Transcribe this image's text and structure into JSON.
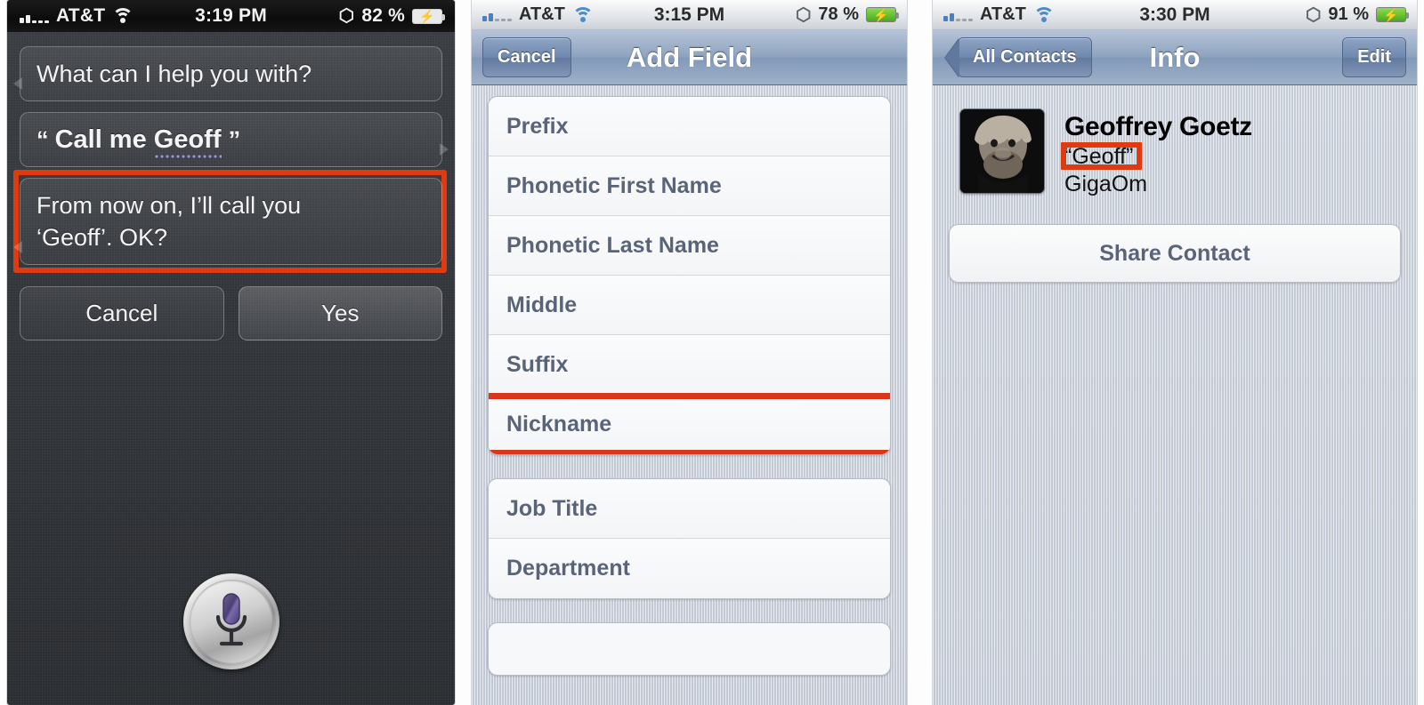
{
  "panels": {
    "siri": {
      "name": "Siri",
      "statusbar": {
        "carrier": "AT&T",
        "time": "3:19 PM",
        "battery_percent": "82 %",
        "signal_bars_filled": 2,
        "signal_bars_total": 5,
        "wifi_icon": "wifi-icon",
        "bluetooth_icon": "bluetooth-icon",
        "battery_icon": "battery-charging-icon"
      },
      "bubbles": [
        {
          "role": "siri",
          "text": "What can I help you with?"
        },
        {
          "role": "user",
          "prefix": "“",
          "text_before": "Call me ",
          "dotted_word": "Geoff",
          "suffix": "”"
        },
        {
          "role": "siri",
          "line1": "From now on, I’ll call you",
          "line2": "‘Geoff’. OK?",
          "highlighted": true
        }
      ],
      "buttons": {
        "cancel": "Cancel",
        "confirm": "Yes"
      },
      "mic_icon": "microphone-icon",
      "highlight_color": "#e03a10"
    },
    "add_field": {
      "statusbar": {
        "carrier": "AT&T",
        "time": "3:15 PM",
        "battery_percent": "78 %",
        "signal_bars_filled": 2,
        "signal_bars_total": 5,
        "wifi_icon": "wifi-icon",
        "bluetooth_icon": "bluetooth-icon",
        "battery_icon": "battery-charging-icon"
      },
      "navbar": {
        "left_button": "Cancel",
        "title": "Add Field"
      },
      "groups": [
        {
          "rows": [
            {
              "label": "Prefix",
              "highlighted": false
            },
            {
              "label": "Phonetic First Name",
              "highlighted": false
            },
            {
              "label": "Phonetic Last Name",
              "highlighted": false
            },
            {
              "label": "Middle",
              "highlighted": false
            },
            {
              "label": "Suffix",
              "highlighted": false
            },
            {
              "label": "Nickname",
              "highlighted": true
            }
          ]
        },
        {
          "rows": [
            {
              "label": "Job Title",
              "highlighted": false
            },
            {
              "label": "Department",
              "highlighted": false
            }
          ]
        }
      ],
      "highlight_color": "#d9361a"
    },
    "info": {
      "statusbar": {
        "carrier": "AT&T",
        "time": "3:30 PM",
        "battery_percent": "91 %",
        "signal_bars_filled": 2,
        "signal_bars_total": 5,
        "wifi_icon": "wifi-icon",
        "bluetooth_icon": "bluetooth-icon",
        "battery_icon": "battery-charging-icon"
      },
      "navbar": {
        "back_button": "All Contacts",
        "title": "Info",
        "right_button": "Edit"
      },
      "contact": {
        "name": "Geoffrey Goetz",
        "nickname": "“Geoff”",
        "organization": "GigaOm",
        "avatar_icon": "contact-photo",
        "nickname_highlighted": true
      },
      "share_button": "Share Contact",
      "highlight_color": "#e03a10"
    }
  }
}
